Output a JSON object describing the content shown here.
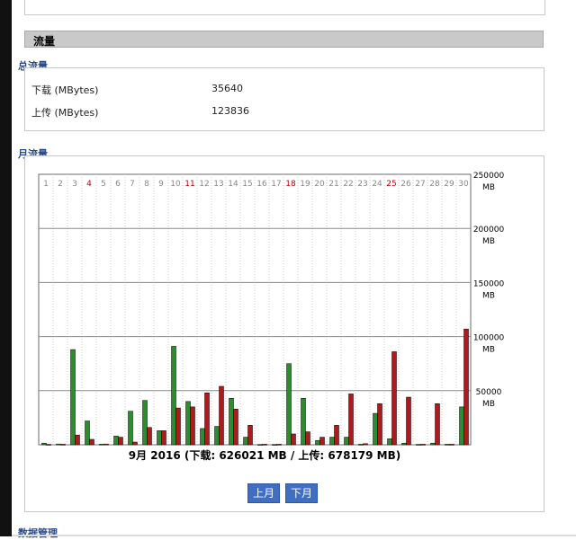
{
  "section": {
    "title": "流量"
  },
  "total": {
    "title": "总流量",
    "rows": [
      {
        "label": "下载 (MBytes)",
        "value": "35640"
      },
      {
        "label": "上传 (MBytes)",
        "value": "123836"
      }
    ]
  },
  "monthly": {
    "title": "月流量"
  },
  "chart_data": {
    "type": "bar",
    "categories": [
      "1",
      "2",
      "3",
      "4",
      "5",
      "6",
      "7",
      "8",
      "9",
      "10",
      "11",
      "12",
      "13",
      "14",
      "15",
      "16",
      "17",
      "18",
      "19",
      "20",
      "21",
      "22",
      "23",
      "24",
      "25",
      "26",
      "27",
      "28",
      "29",
      "30"
    ],
    "highlight_days": [
      "4",
      "11",
      "18",
      "25"
    ],
    "series": [
      {
        "name": "下载",
        "color": "#2e8b2e",
        "values": [
          1500,
          700,
          88000,
          22000,
          600,
          8000,
          31000,
          41000,
          13000,
          91000,
          40000,
          15000,
          17000,
          43000,
          7000,
          300,
          300,
          75000,
          43000,
          4000,
          7000,
          7000,
          500,
          29000,
          5500,
          1500,
          400,
          1500,
          500,
          35000
        ]
      },
      {
        "name": "上传",
        "color": "#b01a1a",
        "values": [
          400,
          500,
          9000,
          5000,
          700,
          7000,
          2500,
          16000,
          13000,
          34000,
          35000,
          48000,
          54000,
          33000,
          18000,
          500,
          500,
          10000,
          12000,
          7000,
          18000,
          47000,
          1000,
          38000,
          86000,
          44000,
          500,
          38000,
          500,
          107000
        ]
      }
    ],
    "ylim": [
      0,
      250000
    ],
    "y_ticks": [
      {
        "value": 250000,
        "label": "250000",
        "unit": "MB"
      },
      {
        "value": 200000,
        "label": "200000",
        "unit": "MB"
      },
      {
        "value": 150000,
        "label": "150000",
        "unit": "MB"
      },
      {
        "value": 100000,
        "label": "100000",
        "unit": "MB"
      },
      {
        "value": 50000,
        "label": "50000",
        "unit": "MB"
      }
    ],
    "caption": "9月 2016 (下载: 626021 MB / 上传: 678179 MB)"
  },
  "nav": {
    "prev_label": "上月",
    "next_label": "下月"
  },
  "footer": {
    "title": "数据管理"
  }
}
